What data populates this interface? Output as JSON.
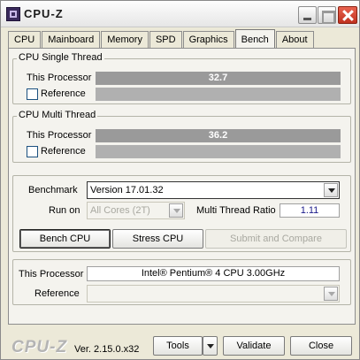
{
  "window": {
    "title": "CPU-Z",
    "min_icon": "minimize-icon",
    "max_icon": "maximize-icon",
    "close_icon": "close-icon"
  },
  "tabs": [
    {
      "label": "CPU",
      "active": false
    },
    {
      "label": "Mainboard",
      "active": false
    },
    {
      "label": "Memory",
      "active": false
    },
    {
      "label": "SPD",
      "active": false
    },
    {
      "label": "Graphics",
      "active": false
    },
    {
      "label": "Bench",
      "active": true
    },
    {
      "label": "About",
      "active": false
    }
  ],
  "single_thread": {
    "title": "CPU Single Thread",
    "this_processor_label": "This Processor",
    "this_processor_value": "32.7",
    "reference_label": "Reference",
    "reference_checked": false
  },
  "multi_thread": {
    "title": "CPU Multi Thread",
    "this_processor_label": "This Processor",
    "this_processor_value": "36.2",
    "reference_label": "Reference",
    "reference_checked": false
  },
  "controls": {
    "benchmark_label": "Benchmark",
    "benchmark_value": "Version 17.01.32",
    "run_on_label": "Run on",
    "run_on_value": "All Cores (2T)",
    "ratio_label": "Multi Thread Ratio",
    "ratio_value": "1.11",
    "bench_button": "Bench CPU",
    "stress_button": "Stress CPU",
    "submit_button": "Submit and Compare"
  },
  "compare": {
    "this_processor_label": "This Processor",
    "this_processor_value": "Intel® Pentium® 4 CPU 3.00GHz",
    "reference_label": "Reference",
    "reference_value": ""
  },
  "footer": {
    "logo": "CPU-Z",
    "version": "Ver. 2.15.0.x32",
    "tools_button": "Tools",
    "validate_button": "Validate",
    "close_button": "Close"
  },
  "colors": {
    "bar_bg": "#b0b0b0",
    "bar_fill": "#9a9a9a",
    "ratio_text": "#1a1a8a"
  }
}
